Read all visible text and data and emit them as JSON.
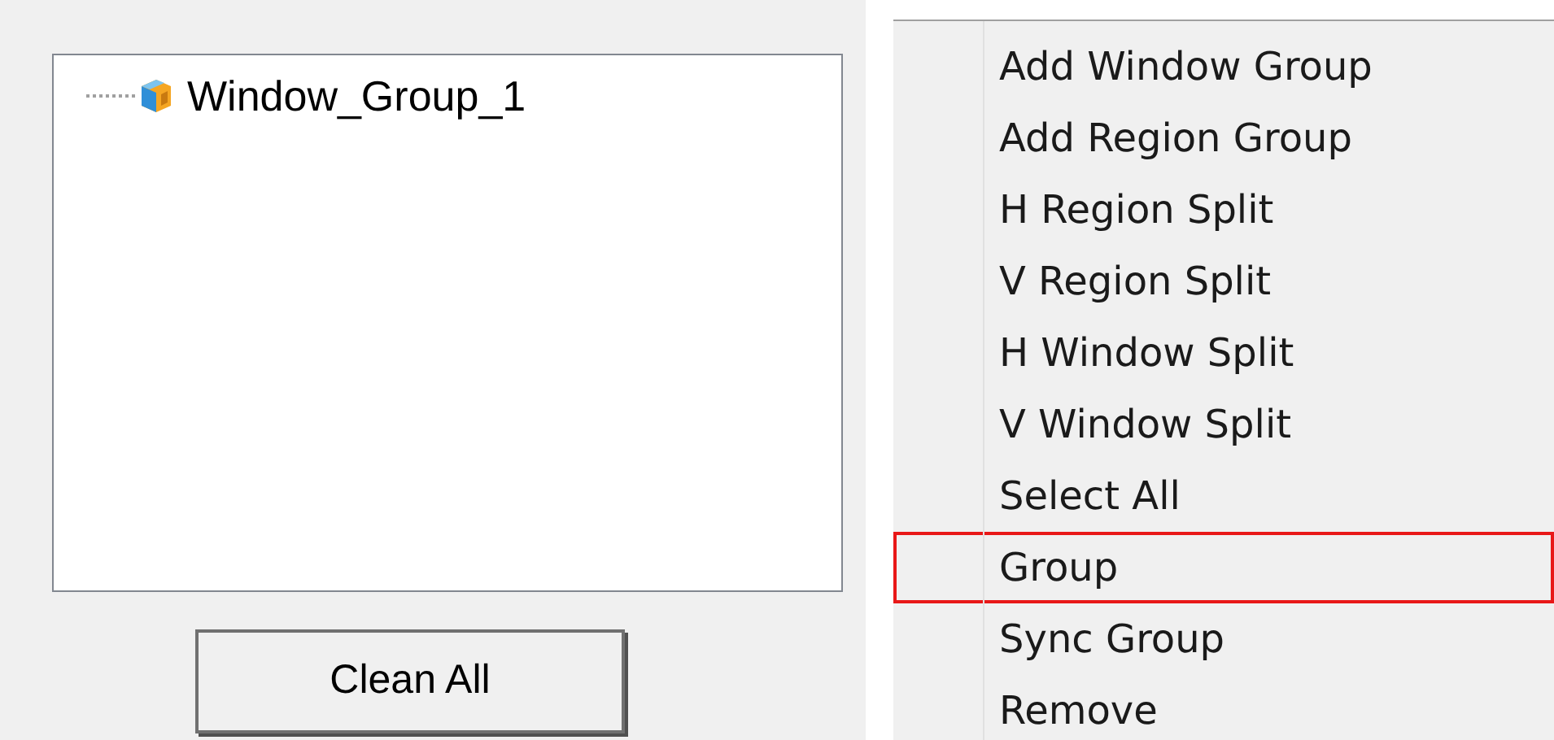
{
  "tree": {
    "items": [
      {
        "label": "Window_Group_1"
      }
    ]
  },
  "button": {
    "label": "Clean All"
  },
  "context_menu": {
    "items": [
      {
        "label": "Add Window Group",
        "selected": false
      },
      {
        "label": "Add Region Group",
        "selected": false
      },
      {
        "label": "H Region Split",
        "selected": false
      },
      {
        "label": "V Region Split",
        "selected": false
      },
      {
        "label": "H Window Split",
        "selected": false
      },
      {
        "label": "V Window Split",
        "selected": false
      },
      {
        "label": "Select All",
        "selected": false
      },
      {
        "label": "Group",
        "selected": true
      },
      {
        "label": "Sync Group",
        "selected": false
      },
      {
        "label": "Remove",
        "selected": false
      }
    ]
  }
}
